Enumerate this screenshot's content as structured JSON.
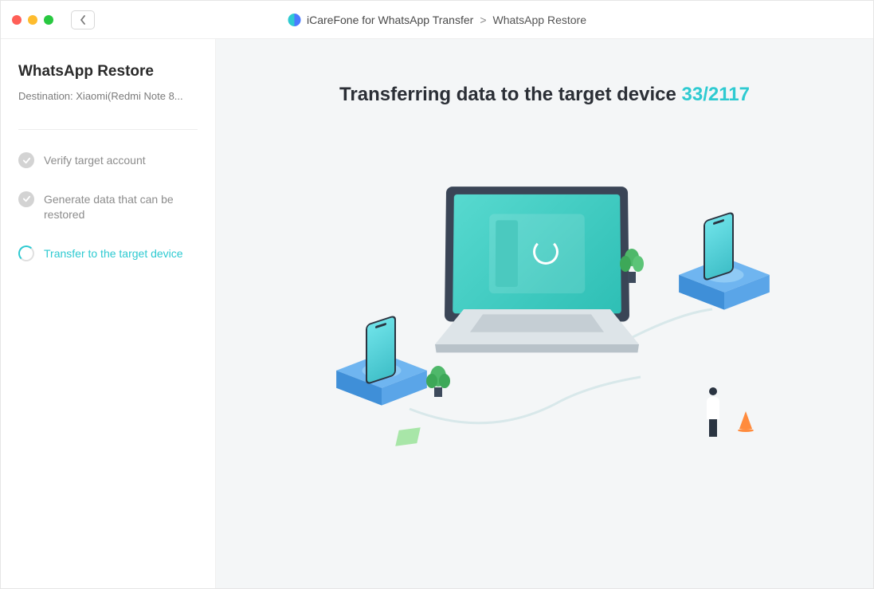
{
  "titlebar": {
    "app_name": "iCareFone for WhatsApp Transfer",
    "separator": ">",
    "page_name": "WhatsApp Restore"
  },
  "sidebar": {
    "title": "WhatsApp Restore",
    "destination_label": "Destination: ",
    "destination_value": "Xiaomi(Redmi Note 8...",
    "steps": [
      {
        "label": "Verify target account",
        "state": "done"
      },
      {
        "label": "Generate data that can be restored",
        "state": "done"
      },
      {
        "label": "Transfer to the target device",
        "state": "active"
      }
    ]
  },
  "main": {
    "progress_label": "Transferring data to the target device ",
    "progress_current": 33,
    "progress_total": 2117,
    "progress_sep": "/"
  },
  "colors": {
    "accent": "#2ecad1"
  }
}
